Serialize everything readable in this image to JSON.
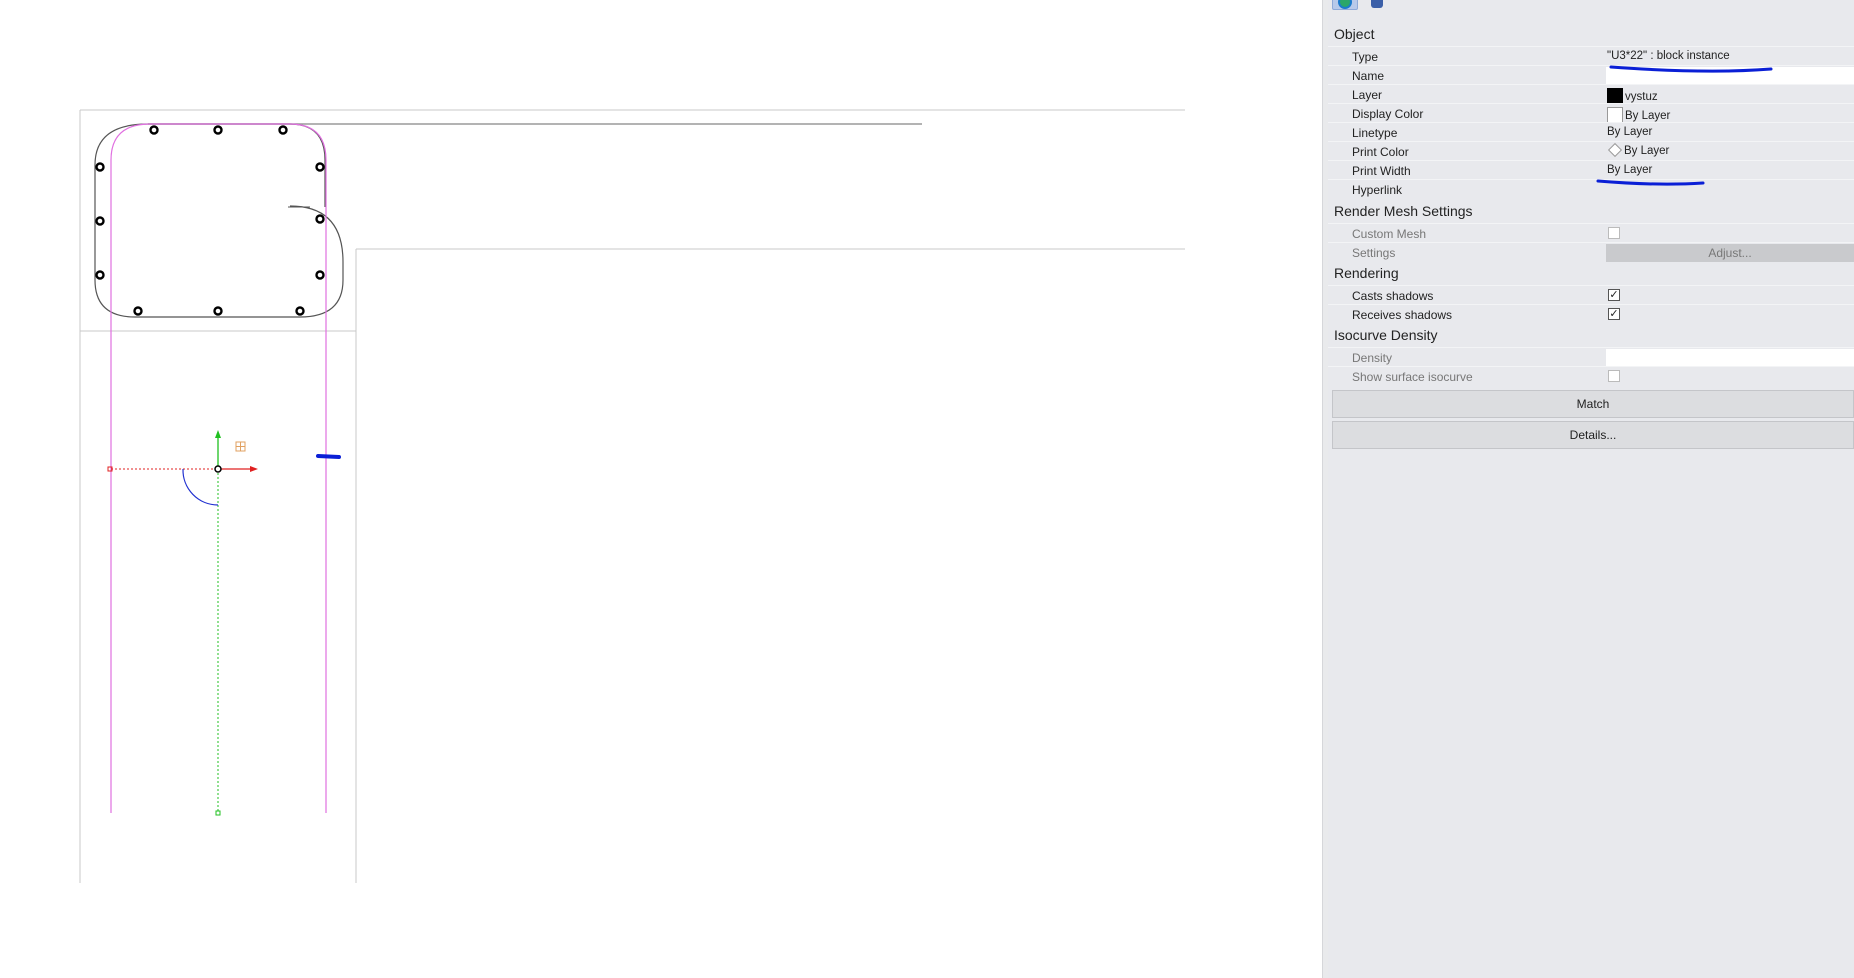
{
  "panel": {
    "sections": {
      "object": "Object",
      "render_mesh": "Render Mesh Settings",
      "rendering": "Rendering",
      "isocurve": "Isocurve Density"
    },
    "object": {
      "type_label": "Type",
      "type_value": "\"U3*22\" : block instance",
      "name_label": "Name",
      "name_value": "",
      "layer_label": "Layer",
      "layer_value": "vystuz",
      "display_color_label": "Display Color",
      "display_color_value": "By Layer",
      "linetype_label": "Linetype",
      "linetype_value": "By Layer",
      "print_color_label": "Print Color",
      "print_color_value": "By Layer",
      "print_width_label": "Print Width",
      "print_width_value": "By Layer",
      "hyperlink_label": "Hyperlink"
    },
    "render_mesh": {
      "custom_mesh_label": "Custom Mesh",
      "custom_mesh_checked": false,
      "settings_label": "Settings",
      "adjust_button": "Adjust..."
    },
    "rendering": {
      "casts_label": "Casts shadows",
      "casts_checked": true,
      "receives_label": "Receives shadows",
      "receives_checked": true
    },
    "isocurve": {
      "density_label": "Density",
      "density_value": "",
      "show_surface_label": "Show surface isocurve",
      "show_surface_checked": false
    },
    "buttons": {
      "match": "Match",
      "details": "Details..."
    }
  },
  "colors": {
    "panel_bg": "#e8e9ed",
    "annotation_ink": "#0a1fd6",
    "curve_magenta": "#e070e0",
    "axis_red": "#e02020",
    "axis_green": "#20c020"
  },
  "icons": [
    "object-properties-icon",
    "material-icon"
  ]
}
